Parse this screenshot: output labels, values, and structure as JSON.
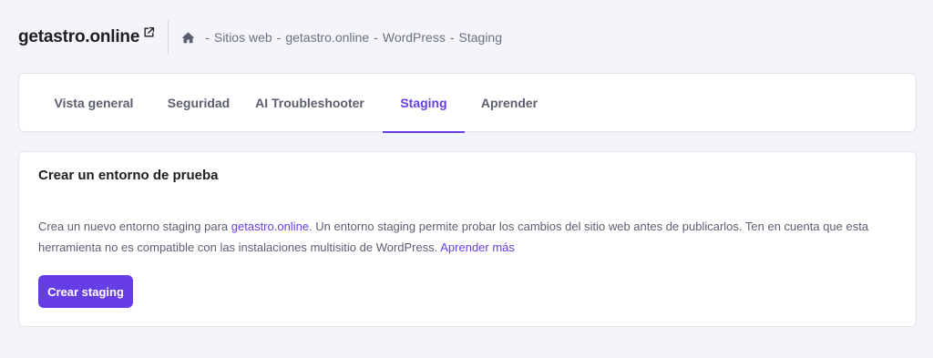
{
  "header": {
    "site_title": "getastro.online",
    "breadcrumb": [
      "Sitios web",
      "getastro.online",
      "WordPress",
      "Staging"
    ],
    "separator": "-"
  },
  "tabs": [
    {
      "label": "Vista general",
      "active": false
    },
    {
      "label": "Seguridad",
      "active": false
    },
    {
      "label": "AI Troubleshooter",
      "active": false
    },
    {
      "label": "Staging",
      "active": true
    },
    {
      "label": "Aprender",
      "active": false
    }
  ],
  "staging_card": {
    "title": "Crear un entorno de prueba",
    "desc_part1": "Crea un nuevo entorno staging para ",
    "desc_link_domain": "getastro.online",
    "desc_part2": ". Un entorno staging permite probar los cambios del sitio web antes de publicarlos. Ten en cuenta que esta herramienta no es compatible con las instalaciones multisitio de WordPress. ",
    "desc_link_learn": "Aprender más",
    "button_label": "Crear staging"
  },
  "colors": {
    "accent": "#673de6",
    "background": "#f4f4fb",
    "text_primary": "#1d1e20",
    "text_secondary": "#5b5e6f"
  },
  "icons": {
    "external_link": "external-link-icon",
    "home": "home-icon"
  }
}
